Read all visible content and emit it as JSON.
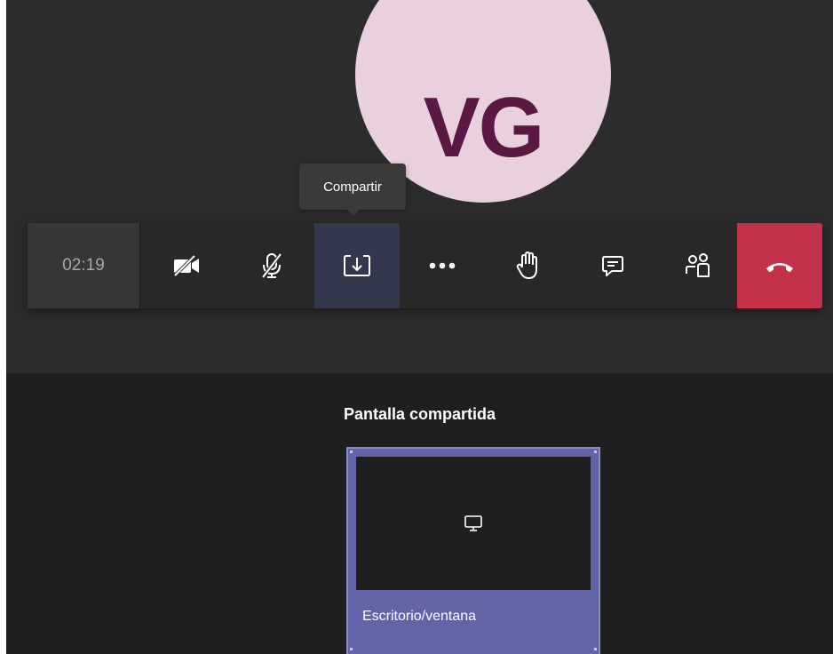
{
  "participant": {
    "initials": "VG"
  },
  "tooltip": {
    "text": "Compartir"
  },
  "toolbar": {
    "timer": "02:19",
    "buttons": [
      {
        "icon": "camera-off-icon",
        "name": "camera-toggle-button"
      },
      {
        "icon": "mic-off-icon",
        "name": "mic-toggle-button"
      },
      {
        "icon": "share-tray-icon",
        "name": "share-button",
        "active": true
      },
      {
        "icon": "more-icon",
        "name": "more-actions-button"
      },
      {
        "icon": "raise-hand-icon",
        "name": "raise-hand-button"
      },
      {
        "icon": "chat-icon",
        "name": "chat-button"
      },
      {
        "icon": "participants-icon",
        "name": "participants-button"
      },
      {
        "icon": "hang-up-icon",
        "name": "hang-up-button"
      }
    ]
  },
  "share_tray": {
    "title": "Pantalla compartida",
    "card": {
      "label": "Escritorio/ventana",
      "icon": "monitor-icon"
    }
  },
  "colors": {
    "accent": "#6264a7",
    "hangup": "#c4314b",
    "avatar_bg": "#e9d0de",
    "avatar_text": "#5a1843"
  }
}
